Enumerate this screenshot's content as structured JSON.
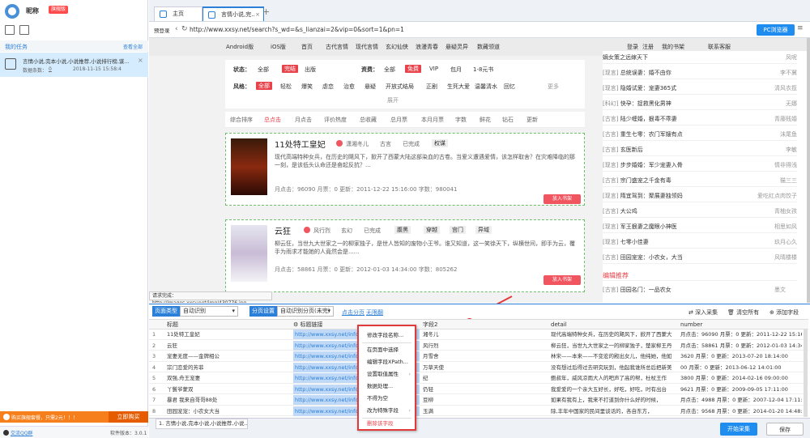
{
  "user": {
    "name": "昵称",
    "vip": "旗舰版"
  },
  "left": {
    "task_title": "我的任务",
    "task_more": "查看全部",
    "task_name": "言情小说,完本小说,小说推荐,小说排行榜,谋...",
    "task_count_label": "数据条数：",
    "task_count": "0",
    "task_time": "2018-11-15 15:58:4",
    "promo_text": "购买旗舰套餐，只需2元！！！",
    "promo_btn": "立即购买",
    "qq_label": "交流QQ群",
    "version": "软件版本：3.0.1"
  },
  "browser": {
    "tab_home": "主页",
    "tab_active": "言情小说,完...",
    "back_label": "预登录",
    "url": "http://www.xxsy.net/search?s_wd=&s_lianzai=2&vip=0&sort=1&pn=1",
    "pc_btn": "PC浏览器"
  },
  "site": {
    "nav": [
      "Android版",
      "iOS版",
      "首页",
      "古代言情",
      "现代言情",
      "玄幻仙侠",
      "浪漫青春",
      "悬疑灵异",
      "数藏领道"
    ],
    "login": "登录",
    "register": "注册",
    "shelf": "我的书架",
    "service": "联系客服"
  },
  "filters": {
    "status_label": "状态：",
    "status": [
      "全部",
      "完结",
      "出版"
    ],
    "fee_label": "资费：",
    "fee": [
      "全部",
      "免费",
      "VIP",
      "包月",
      "1-8元书"
    ],
    "style_label": "风格：",
    "style": [
      "全部",
      "轻松",
      "爆笑",
      "虐恋",
      "治愈",
      "悬疑",
      "开放式结局",
      "正剧",
      "生死大爱",
      "温馨清水",
      "回忆"
    ],
    "more": "更多",
    "expand": "展开"
  },
  "sorttabs": [
    "综合排序",
    "总点击",
    "月点击",
    "评价热度",
    "总收藏",
    "总月票",
    "本月月票",
    "字数",
    "鲜花",
    "钻石",
    "更新"
  ],
  "books": [
    {
      "title": "11处特工皇妃",
      "author": "潇湘冬儿",
      "cat": "古言",
      "status": "已完成",
      "tag": "权谋",
      "desc": "现代高端特种女兵，在历史的飓风下，掀开了西蒙大陆这部染血的古卷。当爱义遭遇爱情，该怎样取舍？在灾难降临的那一刻，是该低头认命还是奋起反抗？...",
      "stats": "月点击：96090  月票：0  更新：2011-12-22 15:16:00    字数：980041",
      "btn": "放入书架"
    },
    {
      "title": "云狂",
      "author": "风行烈",
      "cat": "玄幻",
      "status": "已完成",
      "tag": "腹黑",
      "tag2": "穿越",
      "tag3": "宫门",
      "tag4": "异域",
      "desc": "柳云狂，当世九大世家之一的柳家独子，是世人皆知的废物小王爷。谁又知道，这一笑徐天下，纵横世间，即手为云，覆手为雨求才能她的人竟然会是......",
      "stats": "月点击：58861  月票：0  更新：2012-01-03 14:34:00    字数：805262",
      "btn": "放入书架"
    }
  ],
  "rightlist": [
    {
      "cat": "",
      "title": "嫡女策之远嫁天下",
      "author": "风呢"
    },
    {
      "cat": "[现言]",
      "title": "总统误妻：婚不由你",
      "author": "李不冀"
    },
    {
      "cat": "[现言]",
      "title": "隐婚试爱：宠妻365式",
      "author": "清风衣揽"
    },
    {
      "cat": "[科幻]",
      "title": "快孕：捉救黑化男神",
      "author": "无娜"
    },
    {
      "cat": "[古言]",
      "title": "陆少缠婚，狠毒不乖妻",
      "author": "青藤贱婚"
    },
    {
      "cat": "[古言]",
      "title": "重生七零：农门军嫂有点",
      "author": "沫尾鱼"
    },
    {
      "cat": "[古言]",
      "title": "玄医新后",
      "author": "李敏"
    },
    {
      "cat": "[现言]",
      "title": "步步婚婚：军少宠妻入骨",
      "author": "情非得浅"
    },
    {
      "cat": "[古言]",
      "title": "宗门盛宠之千金有毒",
      "author": "猫三三"
    },
    {
      "cat": "[现言]",
      "title": "隋宜驾到：聚展妻独领妈",
      "author": "爱吃红点肉饺子"
    },
    {
      "cat": "[古言]",
      "title": "大公鸡",
      "author": "青柚女孩"
    },
    {
      "cat": "[现言]",
      "title": "军王狠妻之魔眼小神医",
      "author": "相思如风"
    },
    {
      "cat": "[现言]",
      "title": "七零小佳妻",
      "author": "玖月心久"
    },
    {
      "cat": "[古言]",
      "title": "田园宠宠：小农女，大当",
      "author": "风晴楼楼"
    }
  ],
  "recommend": {
    "title": "编辑推荐",
    "item_title": "田园名门：一品农女",
    "item_author": "墨文"
  },
  "statusbar": "请求完成：http://images.xxsy.net/img/430776.jpg",
  "cfg": {
    "type_btn": "页面类型",
    "type_val": "自动识别",
    "page_btn": "分页设置",
    "page_val": "自动识别分页(未完)",
    "next_btn": "点击分页",
    "next2": "无限翻",
    "deep": "深入采集",
    "clear": "清空所有",
    "add": "添加字段"
  },
  "grid": {
    "headers": [
      "标题",
      "标题链接",
      "字段2",
      "detail",
      "number"
    ],
    "rows": [
      {
        "n": "1",
        "title": "11处特工皇妃",
        "link": "http://www.xxsy.net/info/18",
        "f2": "湘冬儿",
        "detail": "现代高端特种女兵，在历史的飓风下，掀开了西蒙大",
        "number": "月点击：96090 月票：0 更新：2011-12-22 15:16:00"
      },
      {
        "n": "2",
        "title": "云狂",
        "link": "http://www.xxsy.net/info/17",
        "f2": "风行烈",
        "detail": "柳云狂，当世九大世家之一的柳家独子，楚家柳王丹",
        "number": "月点击：58861 月票：0 更新：2012-01-03 14:34:00"
      },
      {
        "n": "3",
        "title": "宠妻无度——金牌相公",
        "author": "",
        "link": "http://www.xxsy.net/info/49",
        "f2": "月雪舍",
        "detail": "林宋——本来——不变宏的殿出女儿，他纯她，他如",
        "number": "3620 月票：0 更新：2013-07-20 18:14:00"
      },
      {
        "n": "4",
        "title": "宗门恋爱的芳菲",
        "link": "http://www.xxsy.net/info/43",
        "f2": "万草天使",
        "detail": "没有想过后得过去研究玩到，他起我谁所总后把新美",
        "number": "00 月票：0 更新：2013-06-12 14:01:00"
      },
      {
        "n": "5",
        "title": "双强,舟王宠妻",
        "link": "http://www.xxsy.net/info/44",
        "f2": "纪",
        "detail": "鲍叔年，威风凉雨大人的吧声了高的帮，杜杖王作",
        "number": "3800 月票：0 更新：2014-02-16 09:00:00"
      },
      {
        "n": "6",
        "title": "丫鬟爷蒙双",
        "link": "http://www.xxsy.net/info/45",
        "f2": "仍轻",
        "detail": "我爱爱的一个亲大五好长，好吃，好吃，时有出台",
        "number": "9621 月票：0 更新：2009-09-05 17:11:00"
      },
      {
        "n": "7",
        "title": "暴君 我来自哥哥88处",
        "link": "http://www.xxsy.net/info/46",
        "f2": "豆柳",
        "detail": "如果有我有上，我来不打道到你什么好的时候，",
        "number": "月点击：4988 月票：0 更新：2007-12-04 17:11:00"
      },
      {
        "n": "8",
        "title": "田园宠宠：小农女大当",
        "link": "http://www.xxsy.net/info/47",
        "f2": "玉满",
        "detail": "除,丰年中国家的民间里谈话的，各自东方，",
        "number": "月点击：9568 月票：0 更新：2014-01-20 14:48:00"
      }
    ]
  },
  "footer": {
    "tab": "1. 言情小说,完本小说,小说推荐,小说...",
    "start": "开始采集",
    "save": "保存"
  },
  "ctx": [
    "修改字段名称...",
    "在页面中选择",
    "编辑字段XPath...",
    "设置取值属性",
    "数据处理...",
    "不得为空",
    "改为特殊字段",
    "删除该字段"
  ]
}
